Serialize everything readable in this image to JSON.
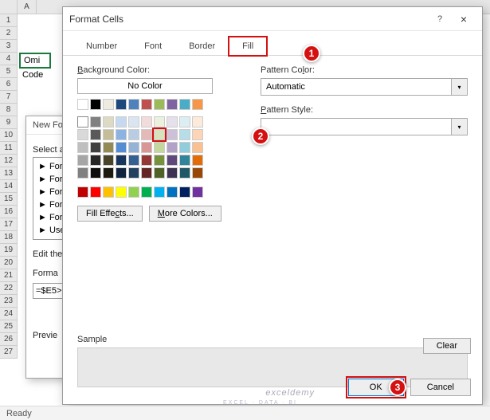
{
  "sheet": {
    "col_a": "A",
    "rows": [
      "1",
      "2",
      "3",
      "4",
      "5",
      "6",
      "7",
      "8",
      "9",
      "10",
      "11",
      "12",
      "13",
      "14",
      "15",
      "16",
      "17",
      "18",
      "19",
      "20",
      "21",
      "22",
      "23",
      "24",
      "25",
      "26",
      "27"
    ],
    "cell_omi": "Omi",
    "cell_code": "Code"
  },
  "under_dialog": {
    "title": "New Fo",
    "select_label": "Select a",
    "items": [
      "► Form",
      "► Form",
      "► Form",
      "► Form",
      "► Form",
      "► Use"
    ],
    "edit_label": "Edit the",
    "forma_label": "Forma",
    "formula": "=$E5>",
    "preview_label": "Previe"
  },
  "dialog": {
    "title": "Format Cells",
    "help": "?",
    "close": "×",
    "tabs": {
      "number": "Number",
      "font": "Font",
      "border": "Border",
      "fill": "Fill"
    },
    "bg_label": "Background Color:",
    "no_color": "No Color",
    "fill_effects": "Fill Effects...",
    "more_colors": "More Colors...",
    "pattern_color_label": "Pattern Color:",
    "pattern_color_value": "Automatic",
    "pattern_style_label": "Pattern Style:",
    "sample_label": "Sample",
    "clear": "Clear",
    "ok": "OK",
    "cancel": "Cancel"
  },
  "swatches": {
    "row1": [
      "#ffffff",
      "#000000",
      "#eeece1",
      "#1f497d",
      "#4f81bd",
      "#c0504d",
      "#9bbb59",
      "#8064a2",
      "#4bacc6",
      "#f79646"
    ],
    "gap": true,
    "row2": [
      "#f2f2f2",
      "#808080",
      "#ddd9c3",
      "#c6d9f0",
      "#dbe5f1",
      "#f2dcdb",
      "#ebf1dd",
      "#e5e0ec",
      "#dbeef3",
      "#fdeada"
    ],
    "row3": [
      "#d9d9d9",
      "#595959",
      "#c4bd97",
      "#8db3e2",
      "#b8cce4",
      "#e5b9b7",
      "#d7e3bc",
      "#ccc1d9",
      "#b7dde8",
      "#fbd5b5"
    ],
    "row4": [
      "#bfbfbf",
      "#404040",
      "#948a54",
      "#548dd4",
      "#95b3d7",
      "#d99694",
      "#c3d69b",
      "#b2a2c7",
      "#92cddc",
      "#fac08f"
    ],
    "row5": [
      "#a6a6a6",
      "#262626",
      "#494429",
      "#17365d",
      "#366092",
      "#953734",
      "#76923c",
      "#5f497a",
      "#31859b",
      "#e36c09"
    ],
    "row6": [
      "#808080",
      "#0d0d0d",
      "#1d1b10",
      "#0f243e",
      "#244061",
      "#632423",
      "#4f6128",
      "#3f3151",
      "#205867",
      "#974806"
    ],
    "std": [
      "#c00000",
      "#ff0000",
      "#ffc000",
      "#ffff00",
      "#92d050",
      "#00b050",
      "#00b0f0",
      "#0070c0",
      "#002060",
      "#7030a0"
    ]
  },
  "callouts": {
    "c1": "1",
    "c2": "2",
    "c3": "3"
  },
  "status": {
    "ready": "Ready"
  },
  "watermark": {
    "text": "exceldemy",
    "sub": "EXCEL · DATA · BI"
  }
}
